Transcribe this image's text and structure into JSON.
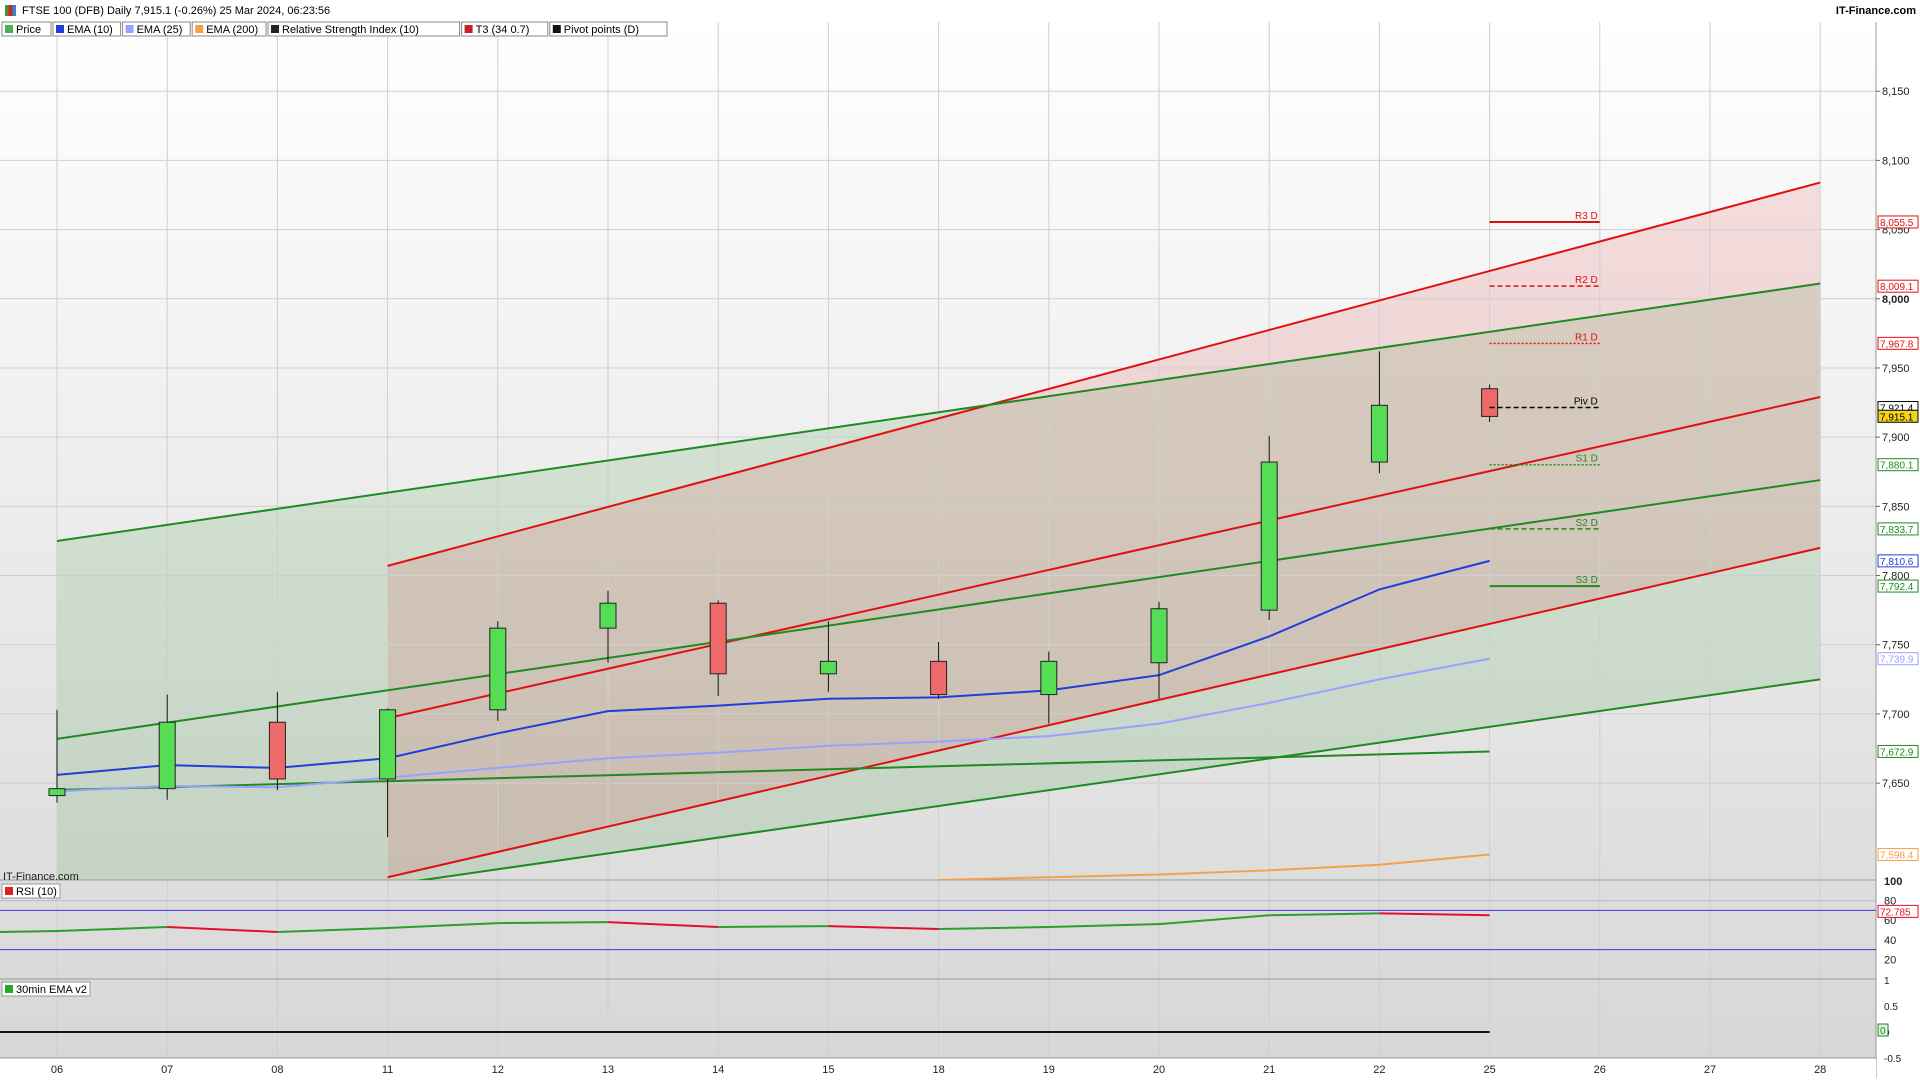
{
  "header": {
    "title": "FTSE 100 (DFB) Daily 7,915.1 (-0.26%) 25 Mar 2024, 06:23:56",
    "brand": "IT-Finance.com"
  },
  "legend": [
    {
      "label": "Price",
      "color": "#4caf50"
    },
    {
      "label": "EMA (10)",
      "color": "#1f3fd8"
    },
    {
      "label": "EMA (25)",
      "color": "#9aa0ff"
    },
    {
      "label": "EMA (200)",
      "color": "#f7a04a"
    },
    {
      "label": "Relative Strength Index (10)",
      "color": "#222222"
    },
    {
      "label": "T3 (34 0.7)",
      "color": "#c82020"
    },
    {
      "label": "Pivot points (D)",
      "color": "#111111"
    }
  ],
  "watermark": "IT-Finance.com",
  "colors": {
    "up": "#55dd55",
    "down": "#ee6a6a",
    "ema10": "#1f3fd8",
    "ema25": "#9aa0ff",
    "ema200": "#f7a04a",
    "resist": "#e01010",
    "support": "#1f8a1f",
    "pivot": "#000000"
  },
  "chart_data": [
    {
      "type": "candlestick",
      "x_labels": [
        "06",
        "07",
        "08",
        "11",
        "12",
        "13",
        "14",
        "15",
        "18",
        "19",
        "20",
        "21",
        "22",
        "25",
        "26",
        "27",
        "28"
      ],
      "ylim": [
        7580,
        8200
      ],
      "y_ticks": [
        "7,650",
        "7,700",
        "7,750",
        "7,800",
        "7,850",
        "7,900",
        "7,950",
        "8,000",
        "8,050",
        "8,100",
        "8,150"
      ],
      "y_tick_values": [
        7650,
        7700,
        7750,
        7800,
        7850,
        7900,
        7950,
        8000,
        8050,
        8100,
        8150
      ],
      "candles": [
        {
          "x": "06",
          "open": 7641,
          "high": 7703,
          "low": 7636,
          "close": 7646
        },
        {
          "x": "07",
          "open": 7646,
          "high": 7714,
          "low": 7638,
          "close": 7694
        },
        {
          "x": "08",
          "open": 7694,
          "high": 7716,
          "low": 7645,
          "close": 7653
        },
        {
          "x": "11",
          "open": 7653,
          "high": 7704,
          "low": 7611,
          "close": 7703
        },
        {
          "x": "12",
          "open": 7703,
          "high": 7767,
          "low": 7695,
          "close": 7762
        },
        {
          "x": "13",
          "open": 7762,
          "high": 7789,
          "low": 7737,
          "close": 7780
        },
        {
          "x": "14",
          "open": 7780,
          "high": 7782,
          "low": 7713,
          "close": 7729
        },
        {
          "x": "15",
          "open": 7729,
          "high": 7767,
          "low": 7716,
          "close": 7738
        },
        {
          "x": "18",
          "open": 7738,
          "high": 7752,
          "low": 7711,
          "close": 7714
        },
        {
          "x": "19",
          "open": 7714,
          "high": 7745,
          "low": 7693,
          "close": 7738
        },
        {
          "x": "20",
          "open": 7737,
          "high": 7781,
          "low": 7711,
          "close": 7776
        },
        {
          "x": "21",
          "open": 7775,
          "high": 7901,
          "low": 7768,
          "close": 7882
        },
        {
          "x": "22",
          "open": 7882,
          "high": 7962,
          "low": 7874,
          "close": 7923
        },
        {
          "x": "25",
          "open": 7935,
          "high": 7938,
          "low": 7911,
          "close": 7915
        }
      ],
      "series": [
        {
          "name": "EMA (10)",
          "x": [
            "06",
            "07",
            "08",
            "11",
            "12",
            "13",
            "14",
            "15",
            "18",
            "19",
            "20",
            "21",
            "22",
            "25"
          ],
          "values": [
            7656,
            7663,
            7661,
            7668,
            7686,
            7702,
            7706,
            7711,
            7712,
            7717,
            7728,
            7756,
            7790,
            7810.6
          ]
        },
        {
          "name": "EMA (25)",
          "x": [
            "06",
            "07",
            "08",
            "11",
            "12",
            "13",
            "14",
            "15",
            "18",
            "19",
            "20",
            "21",
            "22",
            "25"
          ],
          "values": [
            7644,
            7648,
            7647,
            7654,
            7661,
            7668,
            7672,
            7677,
            7680,
            7684,
            7693,
            7708,
            7725,
            7739.9
          ]
        },
        {
          "name": "EMA (200)",
          "x": [
            "18",
            "19",
            "20",
            "21",
            "22",
            "25"
          ],
          "values": [
            7580,
            7582,
            7584,
            7587,
            7591,
            7598.4
          ]
        }
      ],
      "pivots": [
        {
          "label": "R3 D",
          "value": 8055.5,
          "color": "#e01010",
          "style": "solid"
        },
        {
          "label": "R2 D",
          "value": 8009.1,
          "color": "#e01010",
          "style": "dashed"
        },
        {
          "label": "R1 D",
          "value": 7967.8,
          "color": "#e01010",
          "style": "dotted"
        },
        {
          "label": "Piv D",
          "value": 7921.4,
          "color": "#000000",
          "style": "dashed"
        },
        {
          "label": "S1 D",
          "value": 7880.1,
          "color": "#1f8a1f",
          "style": "dotted"
        },
        {
          "label": "S2 D",
          "value": 7833.7,
          "color": "#1f8a1f",
          "style": "dashed"
        },
        {
          "label": "S3 D",
          "value": 7792.4,
          "color": "#1f8a1f",
          "style": "solid"
        }
      ],
      "price_tags": [
        {
          "value": 8055.5,
          "text": "8,055.5",
          "color": "#e01010",
          "bg": "#ffffff"
        },
        {
          "value": 8009.1,
          "text": "8,009.1",
          "color": "#e01010",
          "bg": "#ffffff"
        },
        {
          "value": 7967.8,
          "text": "7,967.8",
          "color": "#e01010",
          "bg": "#ffffff"
        },
        {
          "value": 7921.4,
          "text": "7,921.4",
          "color": "#000000",
          "bg": "#ffffff"
        },
        {
          "value": 7915.1,
          "text": "7,915.1",
          "color": "#000000",
          "bg": "#f6d21a"
        },
        {
          "value": 7880.1,
          "text": "7,880.1",
          "color": "#1f8a1f",
          "bg": "#ffffff"
        },
        {
          "value": 7833.7,
          "text": "7,833.7",
          "color": "#1f8a1f",
          "bg": "#ffffff"
        },
        {
          "value": 7810.6,
          "text": "7,810.6",
          "color": "#1f3fd8",
          "bg": "#ffffff"
        },
        {
          "value": 7792.4,
          "text": "7,792.4",
          "color": "#1f8a1f",
          "bg": "#ffffff"
        },
        {
          "value": 7739.9,
          "text": "7,739.9",
          "color": "#9aa0ff",
          "bg": "#ffffff"
        },
        {
          "value": 7672.9,
          "text": "7,672.9",
          "color": "#1f8a1f",
          "bg": "#ffffff"
        },
        {
          "value": 7598.4,
          "text": "7,598.4",
          "color": "#f7a04a",
          "bg": "#ffffff"
        }
      ],
      "channels": [
        {
          "color": "#e01010",
          "x1": "11",
          "y1": 7807,
          "x2": "28",
          "y2": 8084
        },
        {
          "color": "#e01010",
          "x1": "11",
          "y1": 7697,
          "x2": "28",
          "y2": 7929
        },
        {
          "color": "#e01010",
          "x1": "11",
          "y1": 7582,
          "x2": "28",
          "y2": 7820
        },
        {
          "color": "#1f8a1f",
          "x1": "06",
          "y1": 7825,
          "x2": "28",
          "y2": 8011
        },
        {
          "color": "#1f8a1f",
          "x1": "06",
          "y1": 7682,
          "x2": "28",
          "y2": 7869
        },
        {
          "color": "#1f8a1f",
          "x1": "06",
          "y1": 7542,
          "x2": "28",
          "y2": 7725
        },
        {
          "color": "#1f8a1f",
          "x1": "06",
          "y1": 7645,
          "x2": "25",
          "y2": 7672.9
        }
      ]
    },
    {
      "type": "line",
      "title": "RSI (10)",
      "ylim": [
        0,
        100
      ],
      "y_ticks": [
        "100",
        "80",
        "60",
        "40",
        "20"
      ],
      "y_tick_values": [
        100,
        80,
        60,
        40,
        20
      ],
      "levels": [
        70,
        30
      ],
      "x": [
        "06",
        "07",
        "08",
        "11",
        "12",
        "13",
        "14",
        "15",
        "18",
        "19",
        "20",
        "21",
        "22",
        "25"
      ],
      "values": [
        48,
        49,
        53,
        48,
        52,
        57,
        58,
        53,
        54,
        51,
        53,
        56,
        65,
        67,
        65
      ],
      "last_tag": "72.785"
    },
    {
      "type": "line",
      "title": "30min EMA v2",
      "ylim": [
        -0.5,
        1
      ],
      "y_ticks": [
        "1",
        "0.5",
        "0",
        "-0.5"
      ],
      "y_tick_values": [
        1,
        0.5,
        0,
        -0.5
      ],
      "value": 0,
      "last_tag": "0"
    }
  ]
}
